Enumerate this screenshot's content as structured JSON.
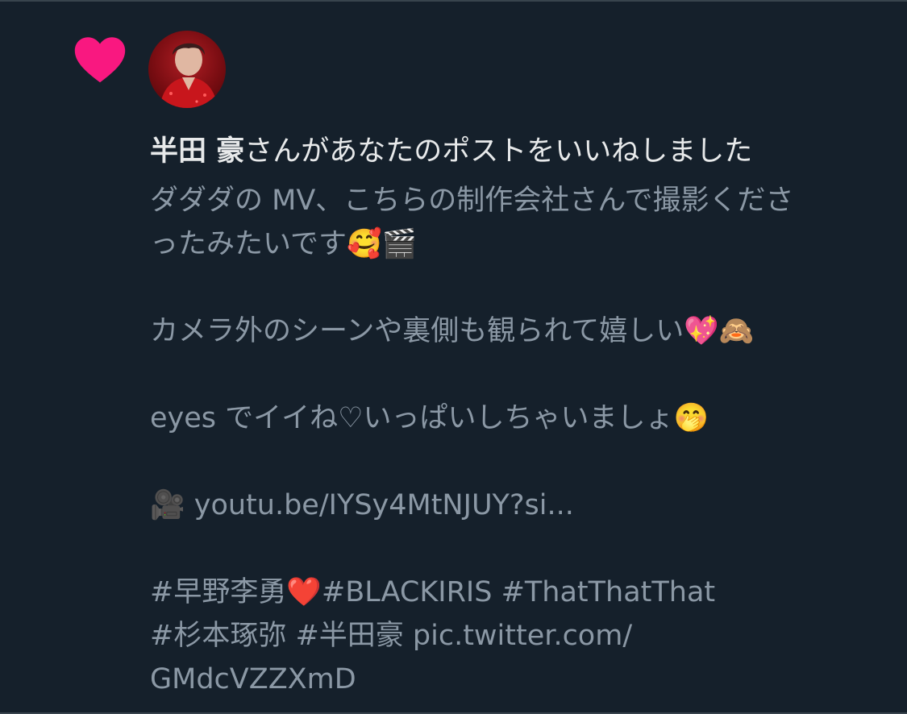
{
  "notification": {
    "type_icon": "heart-icon",
    "user_name": "半田 豪",
    "action_text": "さんがあなたのポストをいいねしました"
  },
  "post": {
    "line1": "ダダダの MV、こちらの制作会社さんで撮影くださ",
    "line2": "ったみたいです",
    "line2_emojis": "🥰🎬",
    "line3": "カメラ外のシーンや裏側も観られて嬉しい",
    "line3_emojis": "💖🙈",
    "line4": "eyes でイイね♡いっぱいしちゃいましょ",
    "line4_emoji": "🤭",
    "link_emoji": "🎥",
    "link": "youtu.be/IYSy4MtNJUY?si...",
    "hashtag_1": "#早野李勇",
    "heart_emoji": "❤️",
    "hashtags_line1_rest": "#BLACKIRIS #ThatThatThat",
    "hashtags_line2": "#杉本琢弥 #半田豪 pic.twitter.com/",
    "pic_link_end": "GMdcVZZXmD"
  },
  "colors": {
    "background": "#15202b",
    "heart": "#f91880",
    "primary_text": "#e7e9ea",
    "secondary_text": "#8b98a5"
  }
}
